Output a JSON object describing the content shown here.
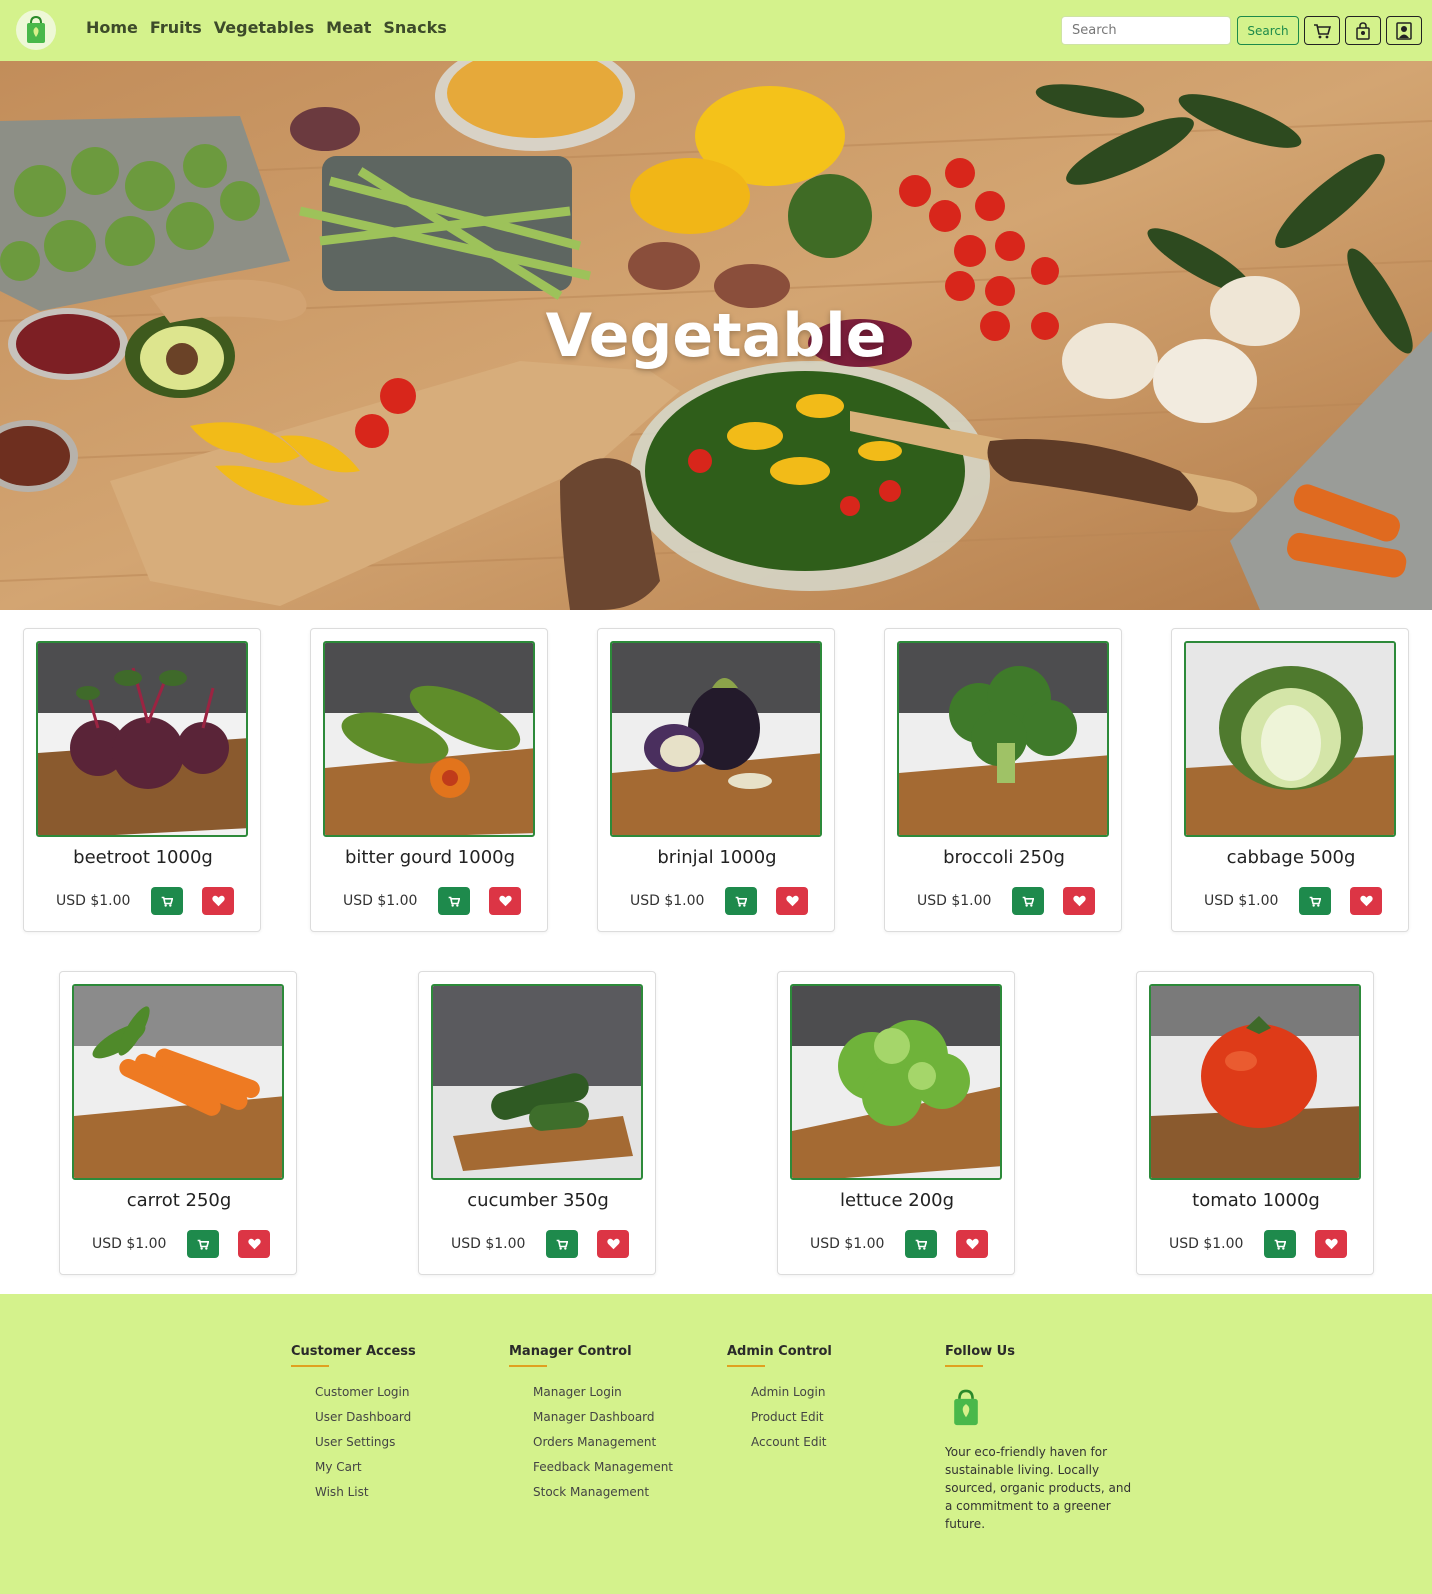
{
  "nav": {
    "links": [
      "Home",
      "Fruits",
      "Vegetables",
      "Meat",
      "Snacks"
    ],
    "search_placeholder": "Search",
    "search_label": "Search"
  },
  "hero": {
    "title": "Vegetable"
  },
  "products": [
    {
      "name": "beetroot 1000g",
      "price": "USD $1.00"
    },
    {
      "name": "bitter gourd 1000g",
      "price": "USD $1.00"
    },
    {
      "name": "brinjal 1000g",
      "price": "USD $1.00"
    },
    {
      "name": "broccoli 250g",
      "price": "USD $1.00"
    },
    {
      "name": "cabbage 500g",
      "price": "USD $1.00"
    },
    {
      "name": "carrot 250g",
      "price": "USD $1.00"
    },
    {
      "name": "cucumber 350g",
      "price": "USD $1.00"
    },
    {
      "name": "lettuce 200g",
      "price": "USD $1.00"
    },
    {
      "name": "tomato 1000g",
      "price": "USD $1.00"
    }
  ],
  "footer": {
    "customer": {
      "heading": "Customer Access",
      "links": [
        "Customer Login",
        "User Dashboard",
        "User Settings",
        "My Cart",
        "Wish List"
      ]
    },
    "manager": {
      "heading": "Manager Control",
      "links": [
        "Manager Login",
        "Manager Dashboard",
        "Orders Management",
        "Feedback Management",
        "Stock Management"
      ]
    },
    "admin": {
      "heading": "Admin Control",
      "links": [
        "Admin Login",
        "Product Edit",
        "Account Edit"
      ]
    },
    "follow": {
      "heading": "Follow Us",
      "text": "Your eco-friendly haven for sustainable living. Locally sourced, organic products, and a commitment to a greener future."
    }
  },
  "colors": {
    "nav_bg": "#d4f28c",
    "cart_green": "#1e8a4c",
    "wish_red": "#dc3545",
    "accent": "#e0a020"
  },
  "icons": [
    "shopping-bag-logo-icon",
    "cart-icon",
    "bag-icon",
    "user-icon",
    "heart-icon"
  ]
}
